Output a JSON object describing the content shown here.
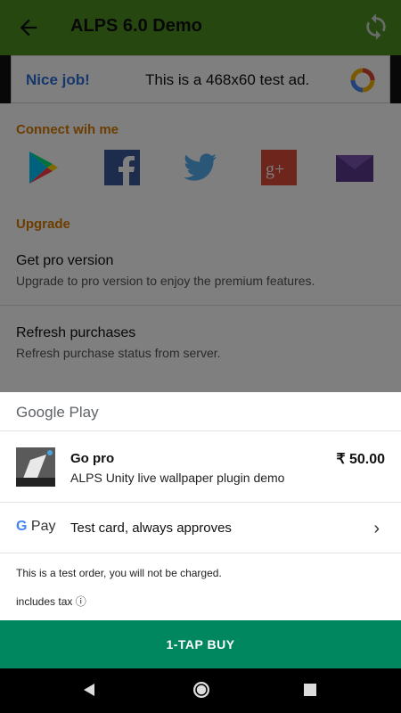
{
  "appbar": {
    "title": "ALPS 6.0 Demo",
    "back_icon": "arrow-left-icon",
    "refresh_icon": "refresh-icon",
    "color": "#4c8f20"
  },
  "ad": {
    "nice": "Nice job!",
    "text": "This is a 468x60 test ad."
  },
  "connect": {
    "header": "Connect wih me",
    "icons": [
      "google-play-icon",
      "facebook-icon",
      "twitter-icon",
      "google-plus-icon",
      "email-icon"
    ]
  },
  "upgrade": {
    "header": "Upgrade",
    "items": [
      {
        "title": "Get pro version",
        "summary": "Upgrade to pro version to enjoy the premium features."
      },
      {
        "title": "Refresh purchases",
        "summary": "Refresh purchase status from server."
      }
    ]
  },
  "sheet": {
    "brand": "Google Play",
    "item_title": "Go pro",
    "item_subtitle": "ALPS Unity live wallpaper plugin demo",
    "price": "₹ 50.00",
    "gpay_label_g": "G",
    "gpay_label_pay": " Pay",
    "payment_method": "Test card, always approves",
    "note": "This is a test order, you will not be charged.",
    "tax": "includes tax ⓘ",
    "buy": "1-TAP BUY",
    "buy_color": "#01875f"
  }
}
